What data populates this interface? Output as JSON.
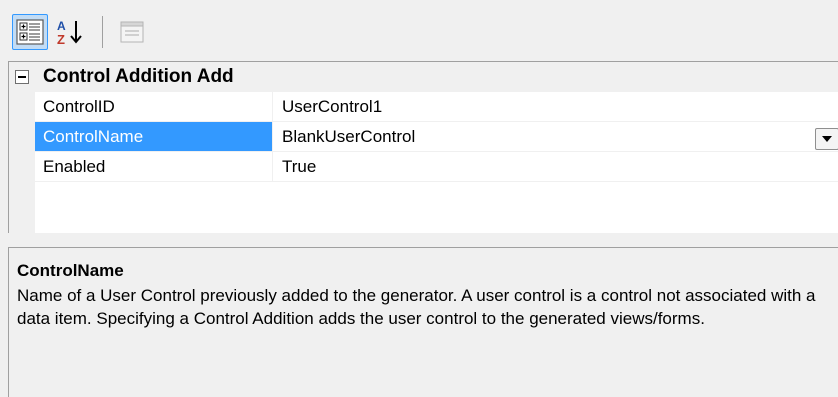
{
  "toolbar": {
    "buttons": [
      {
        "name": "categorized-view",
        "icon": "categorized-icon",
        "pressed": true
      },
      {
        "name": "alphabetical-sort",
        "icon": "az-sort-icon",
        "pressed": false
      },
      {
        "name": "property-pages",
        "icon": "property-pages-icon",
        "pressed": false,
        "disabled": true
      }
    ]
  },
  "grid": {
    "category": {
      "label": "Control Addition Add",
      "expanded": true
    },
    "properties": [
      {
        "name": "ControlID",
        "value": "UserControl1"
      },
      {
        "name": "ControlName",
        "value": "BlankUserControl",
        "selected": true,
        "has_dropdown": true
      },
      {
        "name": "Enabled",
        "value": "True"
      }
    ]
  },
  "description": {
    "title": "ControlName",
    "text": "Name of a User Control previously added to the generator. A user control is a control not associated with a data item. Specifying a Control Addition adds the user control to the generated views/forms."
  },
  "colors": {
    "selection": "#3399ff",
    "background": "#f0f0f0",
    "grid_bg": "#ffffff"
  }
}
